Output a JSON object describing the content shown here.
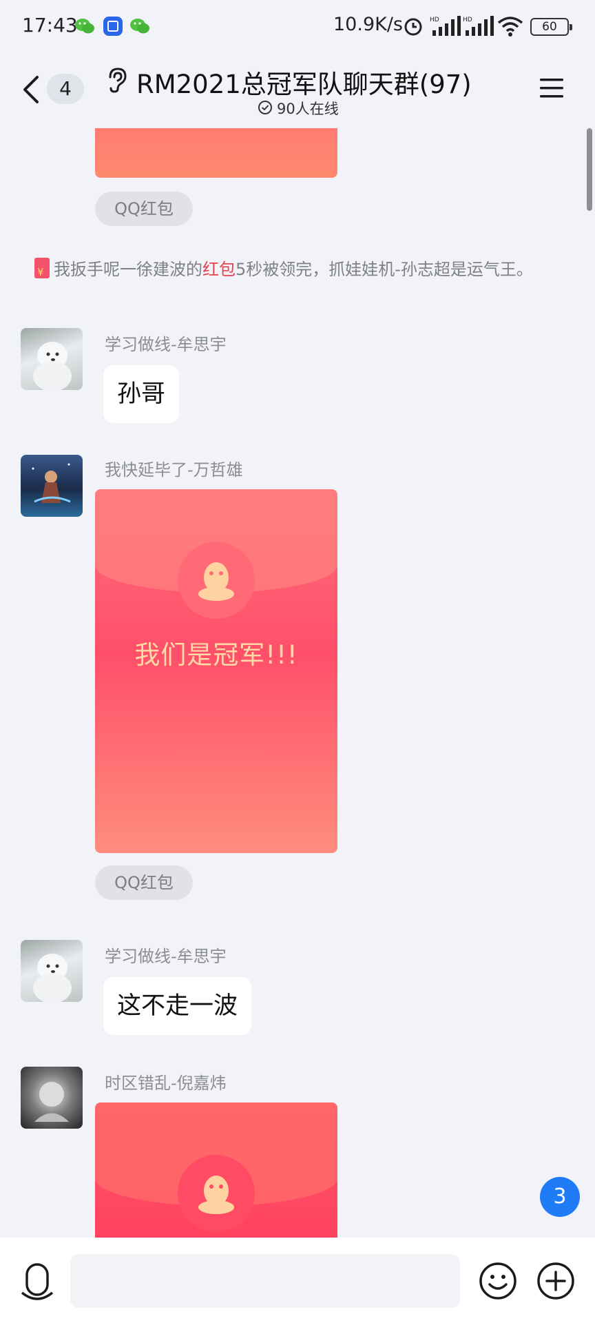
{
  "status_bar": {
    "time": "17:43",
    "network_speed": "10.9K/s",
    "battery": "60"
  },
  "header": {
    "unread_count": "4",
    "title": "RM2021总冠军队聊天群(97)",
    "online": "90人在线"
  },
  "messages": {
    "top_red_packet_tag": "QQ红包",
    "system_notice": {
      "part1": "我扳手呢一徐建波的",
      "highlight": "红包",
      "part2": "5秒被领完，抓娃娃机-孙志超是运气王。"
    },
    "msg1": {
      "sender": "学习做线-牟思宇",
      "text": "孙哥"
    },
    "msg2": {
      "sender": "我快延毕了-万哲雄",
      "red_packet_text": "我们是冠军!!!",
      "tag": "QQ红包"
    },
    "msg3": {
      "sender": "学习做线-牟思宇",
      "text": "这不走一波"
    },
    "msg4": {
      "sender": "时区错乱-倪嘉炜"
    }
  },
  "new_message_badge": "3",
  "input": {
    "placeholder": ""
  },
  "colors": {
    "accent_blue": "#1f7cf6",
    "red_packet": "#ff4f6a",
    "highlight_red": "#e8424f",
    "background": "#f2f3f8"
  }
}
